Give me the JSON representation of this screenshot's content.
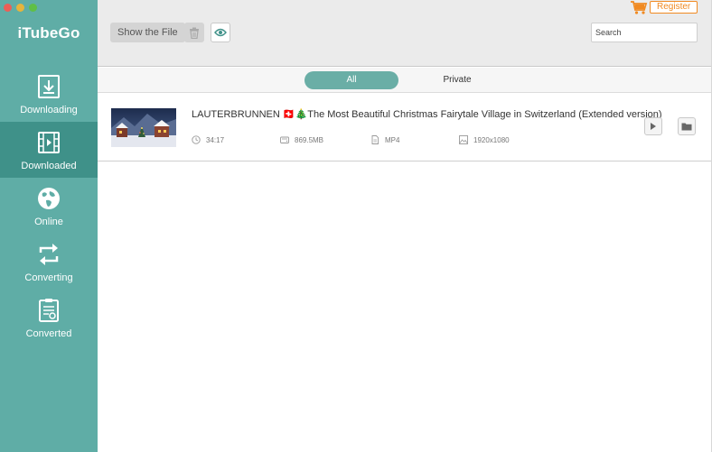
{
  "app": {
    "name": "iTubeGo",
    "accent": "#5fada6",
    "accent_active": "#3f9189"
  },
  "sidebar": {
    "items": [
      {
        "label": "Downloading",
        "icon": "download-icon"
      },
      {
        "label": "Downloaded",
        "icon": "film-icon",
        "active": true
      },
      {
        "label": "Online",
        "icon": "globe-icon"
      },
      {
        "label": "Converting",
        "icon": "convert-icon"
      },
      {
        "label": "Converted",
        "icon": "converted-doc-icon"
      }
    ]
  },
  "toolbar": {
    "show_file_label": "Show the File",
    "trash_icon": "trash-icon",
    "eye_icon": "eye-icon",
    "register_label": "Register",
    "cart_icon": "cart-icon",
    "search_placeholder": "Search"
  },
  "filters": {
    "all_label": "All",
    "private_label": "Private"
  },
  "files": [
    {
      "title": "LAUTERBRUNNEN 🇨🇭🎄The Most Beautiful Christmas Fairytale Village in Switzerland (Extended version)",
      "duration": "34:17",
      "size": "869.5MB",
      "format": "MP4",
      "resolution": "1920x1080"
    }
  ]
}
